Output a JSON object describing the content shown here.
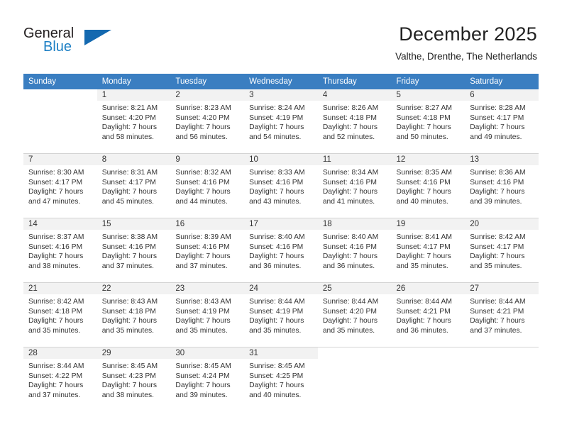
{
  "brand": {
    "name_top": "General",
    "name_bottom": "Blue",
    "triangle_color": "#1469b0",
    "blue_text_color": "#1c7fc4"
  },
  "header": {
    "title": "December 2025",
    "location": "Valthe, Drenthe, The Netherlands"
  },
  "theme": {
    "header_row_bg": "#3a7ec1",
    "header_row_text": "#ffffff",
    "day_number_bg": "#f2f2f2",
    "grid_line": "#d4d4d4"
  },
  "calendar": {
    "weekday_headers": [
      "Sunday",
      "Monday",
      "Tuesday",
      "Wednesday",
      "Thursday",
      "Friday",
      "Saturday"
    ],
    "weeks": [
      [
        {
          "day": "",
          "sunrise": "",
          "sunset": "",
          "daylight_line1": "",
          "daylight_line2": ""
        },
        {
          "day": "1",
          "sunrise": "Sunrise: 8:21 AM",
          "sunset": "Sunset: 4:20 PM",
          "daylight_line1": "Daylight: 7 hours",
          "daylight_line2": "and 58 minutes."
        },
        {
          "day": "2",
          "sunrise": "Sunrise: 8:23 AM",
          "sunset": "Sunset: 4:20 PM",
          "daylight_line1": "Daylight: 7 hours",
          "daylight_line2": "and 56 minutes."
        },
        {
          "day": "3",
          "sunrise": "Sunrise: 8:24 AM",
          "sunset": "Sunset: 4:19 PM",
          "daylight_line1": "Daylight: 7 hours",
          "daylight_line2": "and 54 minutes."
        },
        {
          "day": "4",
          "sunrise": "Sunrise: 8:26 AM",
          "sunset": "Sunset: 4:18 PM",
          "daylight_line1": "Daylight: 7 hours",
          "daylight_line2": "and 52 minutes."
        },
        {
          "day": "5",
          "sunrise": "Sunrise: 8:27 AM",
          "sunset": "Sunset: 4:18 PM",
          "daylight_line1": "Daylight: 7 hours",
          "daylight_line2": "and 50 minutes."
        },
        {
          "day": "6",
          "sunrise": "Sunrise: 8:28 AM",
          "sunset": "Sunset: 4:17 PM",
          "daylight_line1": "Daylight: 7 hours",
          "daylight_line2": "and 49 minutes."
        }
      ],
      [
        {
          "day": "7",
          "sunrise": "Sunrise: 8:30 AM",
          "sunset": "Sunset: 4:17 PM",
          "daylight_line1": "Daylight: 7 hours",
          "daylight_line2": "and 47 minutes."
        },
        {
          "day": "8",
          "sunrise": "Sunrise: 8:31 AM",
          "sunset": "Sunset: 4:17 PM",
          "daylight_line1": "Daylight: 7 hours",
          "daylight_line2": "and 45 minutes."
        },
        {
          "day": "9",
          "sunrise": "Sunrise: 8:32 AM",
          "sunset": "Sunset: 4:16 PM",
          "daylight_line1": "Daylight: 7 hours",
          "daylight_line2": "and 44 minutes."
        },
        {
          "day": "10",
          "sunrise": "Sunrise: 8:33 AM",
          "sunset": "Sunset: 4:16 PM",
          "daylight_line1": "Daylight: 7 hours",
          "daylight_line2": "and 43 minutes."
        },
        {
          "day": "11",
          "sunrise": "Sunrise: 8:34 AM",
          "sunset": "Sunset: 4:16 PM",
          "daylight_line1": "Daylight: 7 hours",
          "daylight_line2": "and 41 minutes."
        },
        {
          "day": "12",
          "sunrise": "Sunrise: 8:35 AM",
          "sunset": "Sunset: 4:16 PM",
          "daylight_line1": "Daylight: 7 hours",
          "daylight_line2": "and 40 minutes."
        },
        {
          "day": "13",
          "sunrise": "Sunrise: 8:36 AM",
          "sunset": "Sunset: 4:16 PM",
          "daylight_line1": "Daylight: 7 hours",
          "daylight_line2": "and 39 minutes."
        }
      ],
      [
        {
          "day": "14",
          "sunrise": "Sunrise: 8:37 AM",
          "sunset": "Sunset: 4:16 PM",
          "daylight_line1": "Daylight: 7 hours",
          "daylight_line2": "and 38 minutes."
        },
        {
          "day": "15",
          "sunrise": "Sunrise: 8:38 AM",
          "sunset": "Sunset: 4:16 PM",
          "daylight_line1": "Daylight: 7 hours",
          "daylight_line2": "and 37 minutes."
        },
        {
          "day": "16",
          "sunrise": "Sunrise: 8:39 AM",
          "sunset": "Sunset: 4:16 PM",
          "daylight_line1": "Daylight: 7 hours",
          "daylight_line2": "and 37 minutes."
        },
        {
          "day": "17",
          "sunrise": "Sunrise: 8:40 AM",
          "sunset": "Sunset: 4:16 PM",
          "daylight_line1": "Daylight: 7 hours",
          "daylight_line2": "and 36 minutes."
        },
        {
          "day": "18",
          "sunrise": "Sunrise: 8:40 AM",
          "sunset": "Sunset: 4:16 PM",
          "daylight_line1": "Daylight: 7 hours",
          "daylight_line2": "and 36 minutes."
        },
        {
          "day": "19",
          "sunrise": "Sunrise: 8:41 AM",
          "sunset": "Sunset: 4:17 PM",
          "daylight_line1": "Daylight: 7 hours",
          "daylight_line2": "and 35 minutes."
        },
        {
          "day": "20",
          "sunrise": "Sunrise: 8:42 AM",
          "sunset": "Sunset: 4:17 PM",
          "daylight_line1": "Daylight: 7 hours",
          "daylight_line2": "and 35 minutes."
        }
      ],
      [
        {
          "day": "21",
          "sunrise": "Sunrise: 8:42 AM",
          "sunset": "Sunset: 4:18 PM",
          "daylight_line1": "Daylight: 7 hours",
          "daylight_line2": "and 35 minutes."
        },
        {
          "day": "22",
          "sunrise": "Sunrise: 8:43 AM",
          "sunset": "Sunset: 4:18 PM",
          "daylight_line1": "Daylight: 7 hours",
          "daylight_line2": "and 35 minutes."
        },
        {
          "day": "23",
          "sunrise": "Sunrise: 8:43 AM",
          "sunset": "Sunset: 4:19 PM",
          "daylight_line1": "Daylight: 7 hours",
          "daylight_line2": "and 35 minutes."
        },
        {
          "day": "24",
          "sunrise": "Sunrise: 8:44 AM",
          "sunset": "Sunset: 4:19 PM",
          "daylight_line1": "Daylight: 7 hours",
          "daylight_line2": "and 35 minutes."
        },
        {
          "day": "25",
          "sunrise": "Sunrise: 8:44 AM",
          "sunset": "Sunset: 4:20 PM",
          "daylight_line1": "Daylight: 7 hours",
          "daylight_line2": "and 35 minutes."
        },
        {
          "day": "26",
          "sunrise": "Sunrise: 8:44 AM",
          "sunset": "Sunset: 4:21 PM",
          "daylight_line1": "Daylight: 7 hours",
          "daylight_line2": "and 36 minutes."
        },
        {
          "day": "27",
          "sunrise": "Sunrise: 8:44 AM",
          "sunset": "Sunset: 4:21 PM",
          "daylight_line1": "Daylight: 7 hours",
          "daylight_line2": "and 37 minutes."
        }
      ],
      [
        {
          "day": "28",
          "sunrise": "Sunrise: 8:44 AM",
          "sunset": "Sunset: 4:22 PM",
          "daylight_line1": "Daylight: 7 hours",
          "daylight_line2": "and 37 minutes."
        },
        {
          "day": "29",
          "sunrise": "Sunrise: 8:45 AM",
          "sunset": "Sunset: 4:23 PM",
          "daylight_line1": "Daylight: 7 hours",
          "daylight_line2": "and 38 minutes."
        },
        {
          "day": "30",
          "sunrise": "Sunrise: 8:45 AM",
          "sunset": "Sunset: 4:24 PM",
          "daylight_line1": "Daylight: 7 hours",
          "daylight_line2": "and 39 minutes."
        },
        {
          "day": "31",
          "sunrise": "Sunrise: 8:45 AM",
          "sunset": "Sunset: 4:25 PM",
          "daylight_line1": "Daylight: 7 hours",
          "daylight_line2": "and 40 minutes."
        },
        {
          "day": "",
          "sunrise": "",
          "sunset": "",
          "daylight_line1": "",
          "daylight_line2": ""
        },
        {
          "day": "",
          "sunrise": "",
          "sunset": "",
          "daylight_line1": "",
          "daylight_line2": ""
        },
        {
          "day": "",
          "sunrise": "",
          "sunset": "",
          "daylight_line1": "",
          "daylight_line2": ""
        }
      ]
    ]
  }
}
